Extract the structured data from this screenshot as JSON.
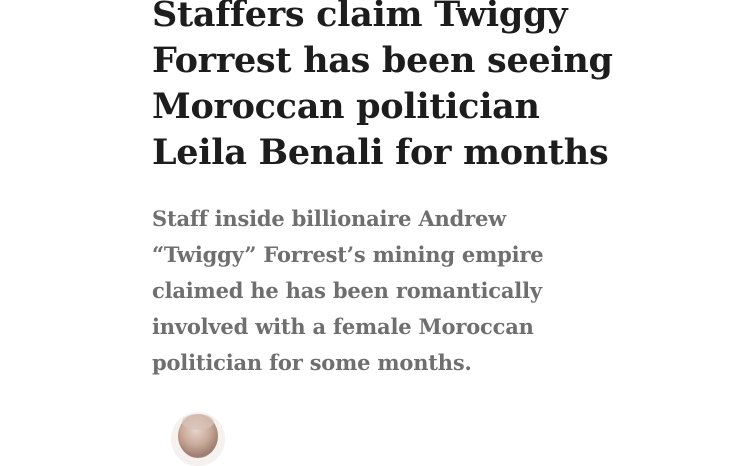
{
  "article": {
    "headline_lines": [
      "Staffers claim Twiggy",
      "Forrest has been seeing",
      "Moroccan politician",
      "Leila Benali for months"
    ],
    "standfirst_lines": [
      "Staff inside billionaire Andrew",
      "“Twiggy” Forrest’s mining empire",
      "claimed he has been romantically",
      "involved with a female Moroccan",
      "politician for some months."
    ]
  },
  "author": {
    "avatar_icon": "author-avatar-photo"
  },
  "colors": {
    "headline": "#1d1d1d",
    "standfirst": "#6f6f6f",
    "background": "#ffffff"
  }
}
